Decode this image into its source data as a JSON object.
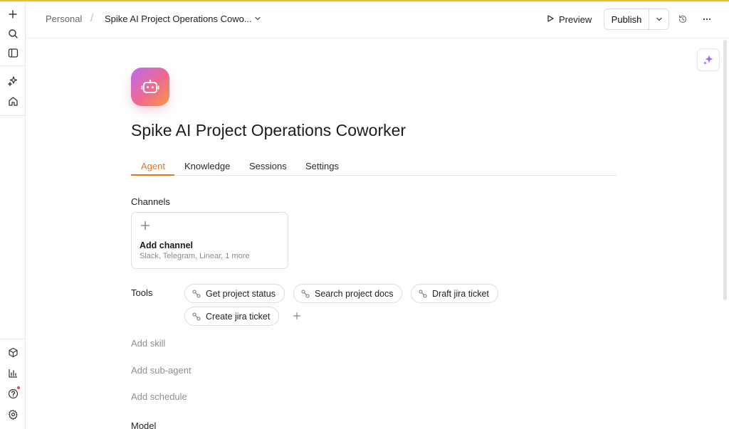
{
  "rail": {
    "top_items": [
      "plus-icon",
      "search-icon",
      "sidebar-toggle-icon"
    ],
    "mid_items": [
      "sparkles-icon",
      "home-icon"
    ],
    "bottom_items": [
      "package-icon",
      "bar-chart-icon",
      "help-icon",
      "gear-icon"
    ],
    "notification_color": "#e5484d"
  },
  "breadcrumb": {
    "workspace": "Personal",
    "separator": "/",
    "title": "Spike AI Project Operations Cowo..."
  },
  "toolbar": {
    "preview_label": "Preview",
    "publish_label": "Publish"
  },
  "agent": {
    "name": "Spike AI Project Operations Coworker",
    "avatar_icon": "robot-icon"
  },
  "tabs": [
    {
      "label": "Agent",
      "active": true
    },
    {
      "label": "Knowledge",
      "active": false
    },
    {
      "label": "Sessions",
      "active": false
    },
    {
      "label": "Settings",
      "active": false
    }
  ],
  "channels": {
    "label": "Channels",
    "add_title": "Add channel",
    "add_subtitle": "Slack, Telegram, Linear, 1 more"
  },
  "tools": {
    "label": "Tools",
    "items": [
      "Get project status",
      "Search project docs",
      "Draft jira ticket",
      "Create jira ticket"
    ]
  },
  "links": {
    "add_skill": "Add skill",
    "add_subagent": "Add sub-agent",
    "add_schedule": "Add schedule",
    "model_label": "Model"
  },
  "colors": {
    "accent": "#e8731c",
    "top_accent": "#f5b731",
    "avatar_gradient": [
      "#b86cf2",
      "#f06a8c",
      "#f59a45"
    ]
  }
}
